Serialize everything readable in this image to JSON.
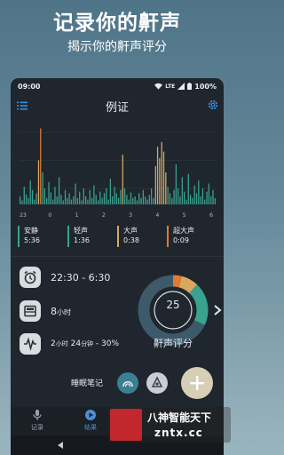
{
  "promo": {
    "title": "记录你的鼾声",
    "subtitle": "揭示你的鼾声评分"
  },
  "status_bar": {
    "time": "09:00",
    "network": "LTE",
    "battery": "100%"
  },
  "app_bar": {
    "title": "例证",
    "left_icon": "menu-icon",
    "right_icon": "settings-gear-icon"
  },
  "chart_data": {
    "type": "bar",
    "x_tick_labels": [
      "23",
      "0",
      "1",
      "2",
      "3",
      "4",
      "5",
      "6"
    ],
    "level_colors": {
      "quiet": "#3aa38f",
      "light": "#3aa38f",
      "loud": "#d9a860",
      "epic": "#e07a36"
    },
    "levels": [
      "quiet",
      "light",
      "loud",
      "epic"
    ],
    "bars": [
      [
        0.1,
        "quiet"
      ],
      [
        0.05,
        "quiet"
      ],
      [
        0.22,
        "light"
      ],
      [
        0.12,
        "light"
      ],
      [
        0.08,
        "quiet"
      ],
      [
        0.3,
        "light"
      ],
      [
        0.18,
        "light"
      ],
      [
        0.06,
        "quiet"
      ],
      [
        0.14,
        "light"
      ],
      [
        0.55,
        "loud"
      ],
      [
        0.95,
        "epic"
      ],
      [
        0.4,
        "light"
      ],
      [
        0.2,
        "light"
      ],
      [
        0.08,
        "quiet"
      ],
      [
        0.28,
        "light"
      ],
      [
        0.15,
        "light"
      ],
      [
        0.06,
        "quiet"
      ],
      [
        0.22,
        "light"
      ],
      [
        0.1,
        "quiet"
      ],
      [
        0.34,
        "light"
      ],
      [
        0.12,
        "light"
      ],
      [
        0.05,
        "quiet"
      ],
      [
        0.18,
        "light"
      ],
      [
        0.08,
        "quiet"
      ],
      [
        0.14,
        "light"
      ],
      [
        0.06,
        "quiet"
      ],
      [
        0.1,
        "quiet"
      ],
      [
        0.26,
        "light"
      ],
      [
        0.08,
        "quiet"
      ],
      [
        0.16,
        "light"
      ],
      [
        0.05,
        "quiet"
      ],
      [
        0.2,
        "light"
      ],
      [
        0.1,
        "quiet"
      ],
      [
        0.06,
        "quiet"
      ],
      [
        0.18,
        "light"
      ],
      [
        0.08,
        "quiet"
      ],
      [
        0.24,
        "light"
      ],
      [
        0.12,
        "light"
      ],
      [
        0.05,
        "quiet"
      ],
      [
        0.16,
        "light"
      ],
      [
        0.08,
        "quiet"
      ],
      [
        0.14,
        "light"
      ],
      [
        0.2,
        "light"
      ],
      [
        0.06,
        "quiet"
      ],
      [
        0.32,
        "light"
      ],
      [
        0.1,
        "quiet"
      ],
      [
        0.22,
        "light"
      ],
      [
        0.14,
        "light"
      ],
      [
        0.08,
        "quiet"
      ],
      [
        0.18,
        "light"
      ],
      [
        0.62,
        "loud"
      ],
      [
        0.2,
        "light"
      ],
      [
        0.12,
        "light"
      ],
      [
        0.06,
        "quiet"
      ],
      [
        0.15,
        "light"
      ],
      [
        0.08,
        "quiet"
      ],
      [
        0.1,
        "quiet"
      ],
      [
        0.05,
        "quiet"
      ],
      [
        0.14,
        "light"
      ],
      [
        0.08,
        "quiet"
      ],
      [
        0.18,
        "light"
      ],
      [
        0.1,
        "quiet"
      ],
      [
        0.06,
        "quiet"
      ],
      [
        0.12,
        "light"
      ],
      [
        0.2,
        "light"
      ],
      [
        0.08,
        "quiet"
      ],
      [
        0.48,
        "loud"
      ],
      [
        0.72,
        "loud"
      ],
      [
        0.58,
        "loud"
      ],
      [
        0.78,
        "loud"
      ],
      [
        0.66,
        "loud"
      ],
      [
        0.4,
        "loud"
      ],
      [
        0.22,
        "light"
      ],
      [
        0.14,
        "light"
      ],
      [
        0.08,
        "quiet"
      ],
      [
        0.18,
        "light"
      ],
      [
        0.5,
        "light"
      ],
      [
        0.2,
        "light"
      ],
      [
        0.1,
        "quiet"
      ],
      [
        0.34,
        "light"
      ],
      [
        0.16,
        "light"
      ],
      [
        0.06,
        "quiet"
      ],
      [
        0.38,
        "light"
      ],
      [
        0.12,
        "light"
      ],
      [
        0.08,
        "quiet"
      ],
      [
        0.24,
        "light"
      ],
      [
        0.14,
        "light"
      ],
      [
        0.3,
        "light"
      ],
      [
        0.1,
        "quiet"
      ],
      [
        0.2,
        "light"
      ],
      [
        0.06,
        "quiet"
      ],
      [
        0.16,
        "light"
      ],
      [
        0.26,
        "light"
      ],
      [
        0.1,
        "quiet"
      ],
      [
        0.18,
        "light"
      ],
      [
        0.08,
        "quiet"
      ]
    ]
  },
  "legend": [
    {
      "label": "安静",
      "time": "5:36",
      "color": "#3aa38f"
    },
    {
      "label": "轻声",
      "time": "1:36",
      "color": "#3aa38f"
    },
    {
      "label": "大声",
      "time": "0:38",
      "color": "#d9a860"
    },
    {
      "label": "超大声",
      "time": "0:09",
      "color": "#e07a36"
    }
  ],
  "summary": {
    "bed_time_range": "22:30 - 6:30",
    "sleep_duration_value": "8",
    "sleep_duration_unit": "小时",
    "snore_time_h": "2",
    "snore_time_h_unit": "小时",
    "snore_time_m": "24",
    "snore_time_m_unit": "分钟",
    "snore_percent": "30%"
  },
  "score": {
    "value": "25",
    "label": "鼾声评分",
    "segments": [
      {
        "level": "epic",
        "fraction": 0.04,
        "color": "#e07a36"
      },
      {
        "level": "loud",
        "fraction": 0.08,
        "color": "#d9a860"
      },
      {
        "level": "light",
        "fraction": 0.2,
        "color": "#3aa38f"
      },
      {
        "level": "rest",
        "fraction": 0.68,
        "color": "#3e5a6a"
      }
    ]
  },
  "notes": {
    "label": "睡眠笔记"
  },
  "bottom_nav": {
    "items": [
      {
        "label": "记录",
        "icon": "microphone-icon",
        "active": false
      },
      {
        "label": "结果",
        "icon": "play-circle-icon",
        "active": true
      }
    ]
  },
  "watermark": {
    "line1": "八神智能天下",
    "line2": "zntx.cc"
  }
}
